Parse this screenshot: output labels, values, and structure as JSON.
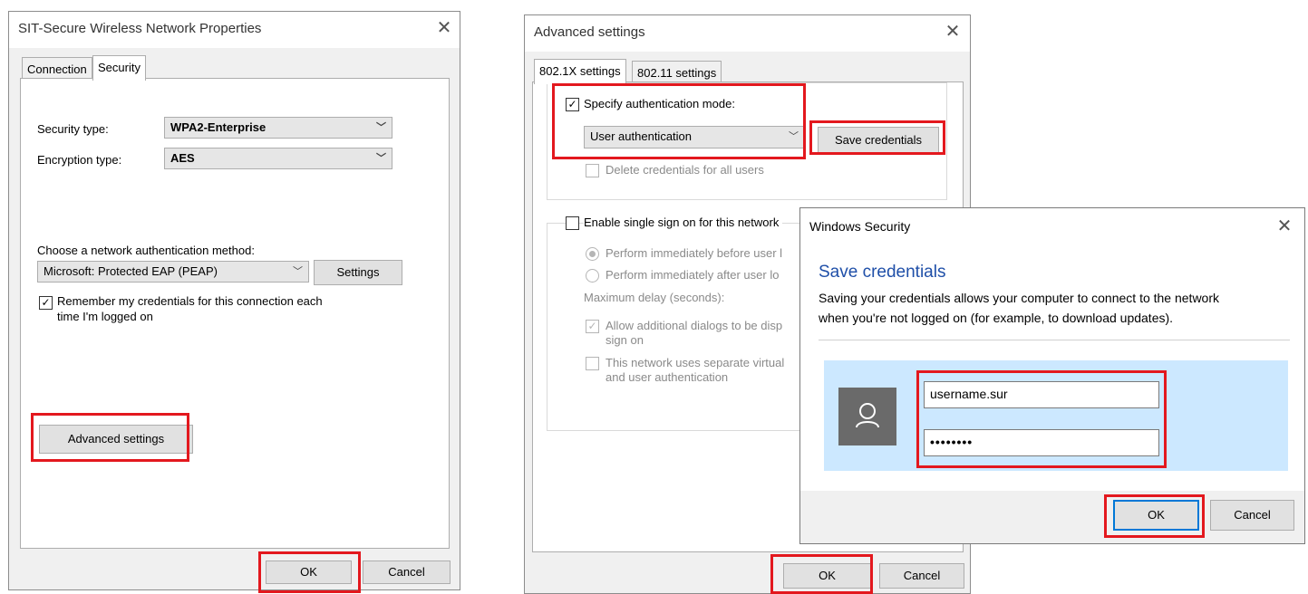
{
  "dialog1": {
    "title": "SIT-Secure Wireless Network Properties",
    "tabs": [
      "Connection",
      "Security"
    ],
    "security_type_label": "Security type:",
    "security_type_value": "WPA2-Enterprise",
    "encryption_type_label": "Encryption type:",
    "encryption_type_value": "AES",
    "auth_method_label": "Choose a network authentication method:",
    "auth_method_value": "Microsoft: Protected EAP (PEAP)",
    "settings_button": "Settings",
    "remember_line1": "Remember my credentials for this connection each",
    "remember_line2": "time I'm logged on",
    "advanced_button": "Advanced settings",
    "ok_button": "OK",
    "cancel_button": "Cancel"
  },
  "dialog2": {
    "title": "Advanced settings",
    "tabs": [
      "802.1X settings",
      "802.11 settings"
    ],
    "specify_auth_label": "Specify authentication mode:",
    "auth_mode_value": "User authentication",
    "save_credentials_button": "Save credentials",
    "delete_credentials_label": "Delete credentials for all users",
    "sso_label": "Enable single sign on for this network",
    "perform_before_label": "Perform immediately before user l",
    "perform_after_label": "Perform immediately after user lo",
    "max_delay_label": "Maximum delay (seconds):",
    "allow_dialogs_line1": "Allow additional dialogs to be disp",
    "allow_dialogs_line2": "sign on",
    "separate_virtual_line1": "This network uses separate virtual",
    "separate_virtual_line2": "and user authentication",
    "ok_button": "OK",
    "cancel_button": "Cancel"
  },
  "dialog3": {
    "title": "Windows Security",
    "heading": "Save credentials",
    "message_line1": "Saving your credentials allows your computer to connect to the network",
    "message_line2": "when you're not logged on (for example, to download updates).",
    "username_value": "username.sur",
    "password_value": "••••••••",
    "ok_button": "OK",
    "cancel_button": "Cancel",
    "heading_color": "#1f4fa8",
    "credential_area_color": "#cce8ff"
  },
  "colors": {
    "highlight": "#e3181e",
    "dialog_bg": "#f0f0f0",
    "accent": "#0078d7"
  }
}
